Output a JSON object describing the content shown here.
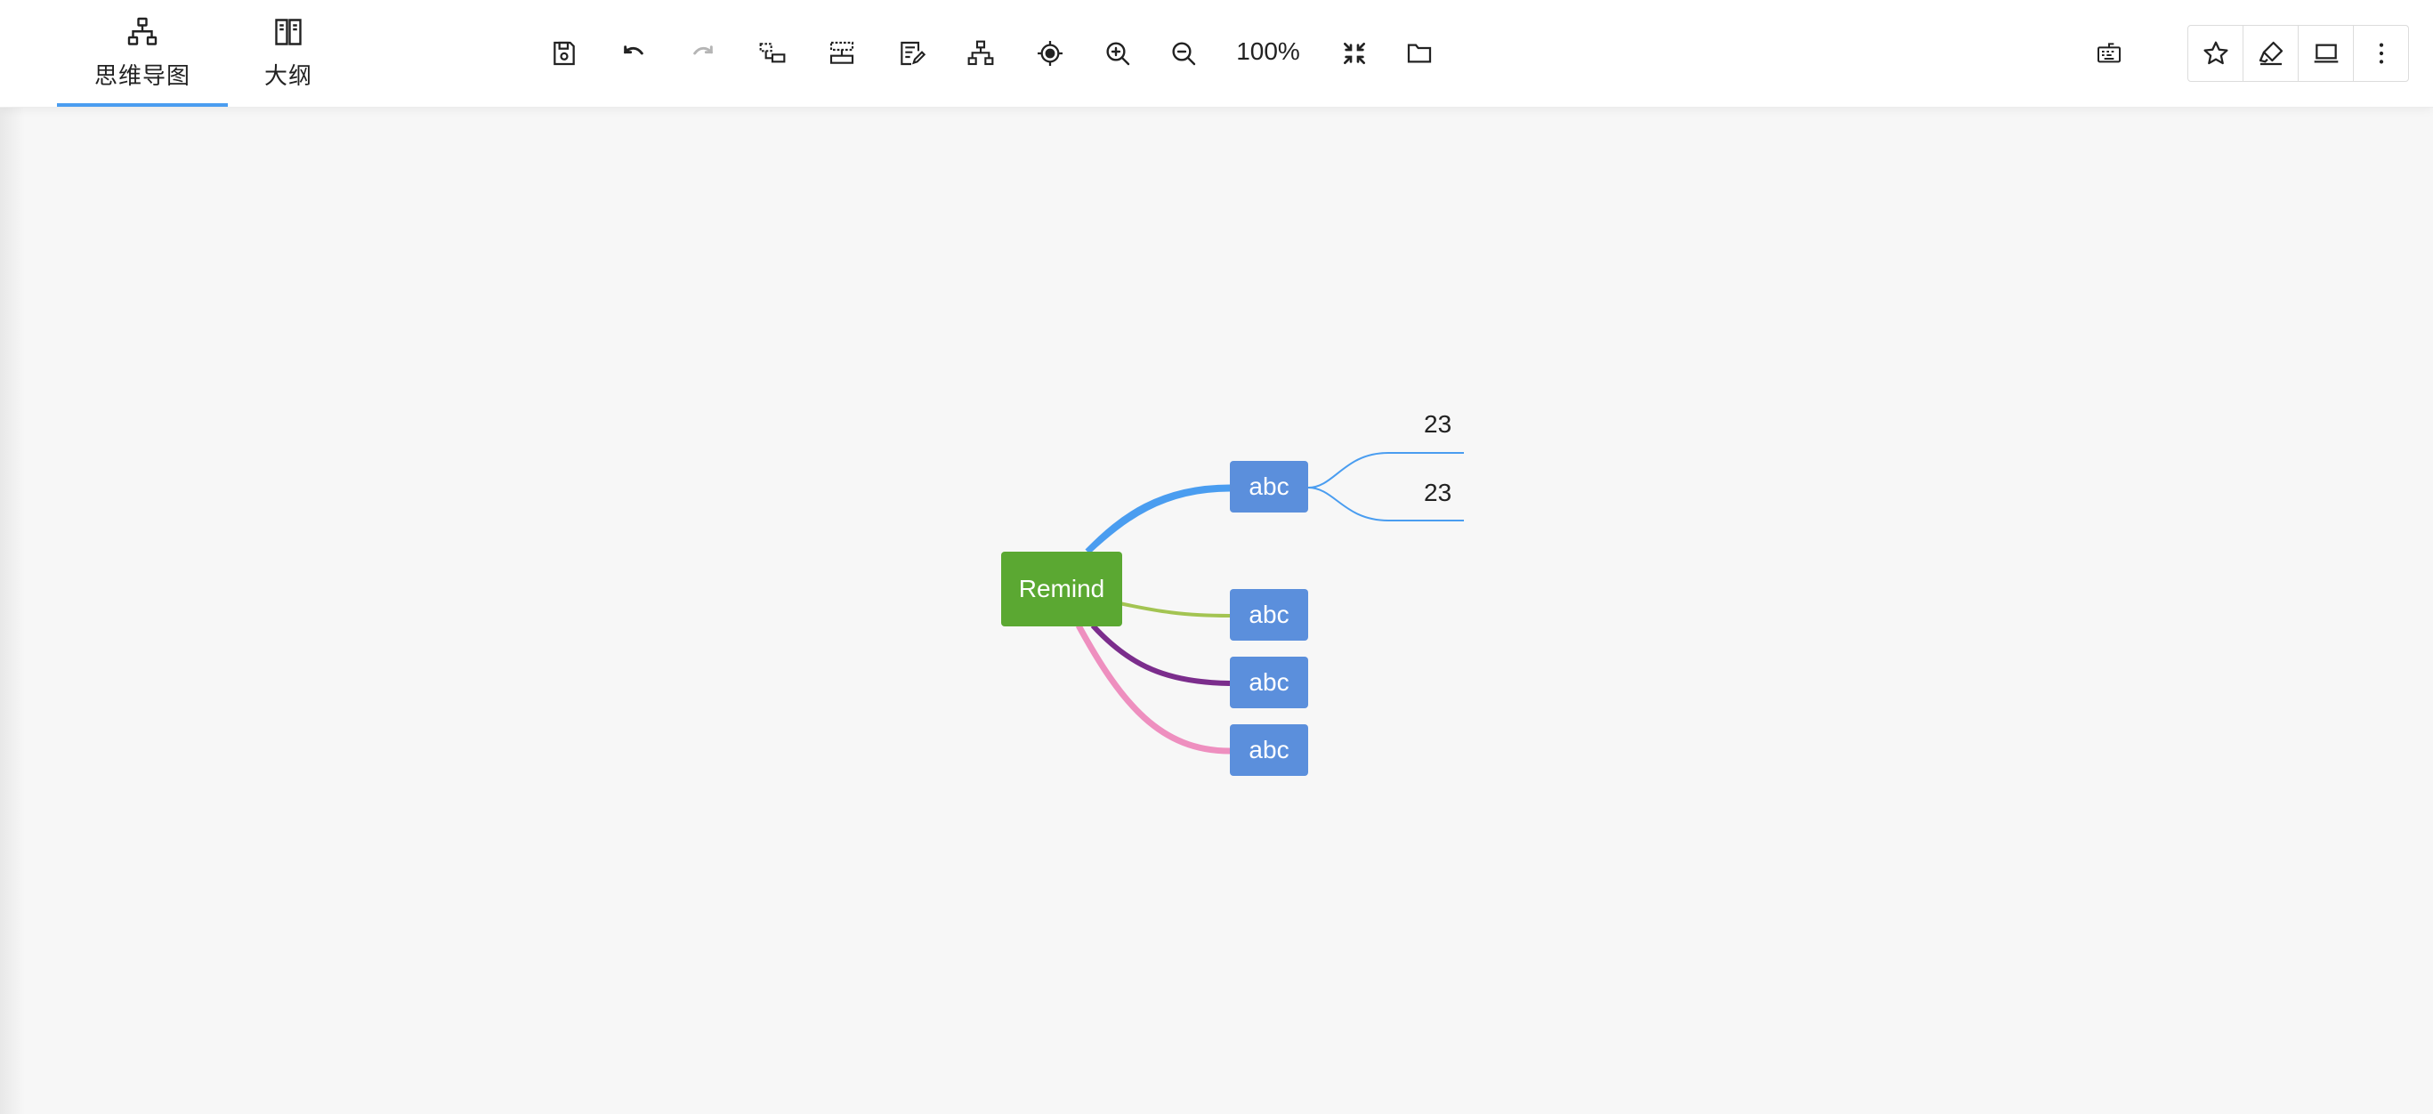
{
  "view_tabs": [
    {
      "label": "思维导图",
      "icon": "mindmap-icon",
      "active": true
    },
    {
      "label": "大纲",
      "icon": "outline-book-icon",
      "active": false
    }
  ],
  "toolbar": {
    "tools": [
      {
        "name": "save",
        "icon": "save-icon",
        "enabled": true
      },
      {
        "name": "undo",
        "icon": "undo-icon",
        "enabled": true
      },
      {
        "name": "redo",
        "icon": "redo-icon",
        "enabled": false
      },
      {
        "name": "insert-child",
        "icon": "insert-child-node-icon",
        "enabled": true
      },
      {
        "name": "insert-sibling",
        "icon": "insert-sibling-node-icon",
        "enabled": true
      },
      {
        "name": "edit-note",
        "icon": "note-edit-icon",
        "enabled": true
      },
      {
        "name": "structure",
        "icon": "structure-icon",
        "enabled": true
      },
      {
        "name": "locate",
        "icon": "locate-center-icon",
        "enabled": true
      },
      {
        "name": "zoom-in",
        "icon": "zoom-in-icon",
        "enabled": true
      },
      {
        "name": "zoom-out",
        "icon": "zoom-out-icon",
        "enabled": true
      },
      {
        "name": "fit",
        "icon": "fit-screen-icon",
        "enabled": true
      },
      {
        "name": "open",
        "icon": "folder-icon",
        "enabled": true
      }
    ],
    "zoom_label": "100%"
  },
  "right_actions": [
    {
      "name": "keyboard",
      "icon": "keyboard-shortcuts-icon"
    },
    {
      "name": "favorite",
      "icon": "star-icon"
    },
    {
      "name": "theme",
      "icon": "highlighter-icon"
    },
    {
      "name": "present",
      "icon": "laptop-icon"
    },
    {
      "name": "more",
      "icon": "more-vertical-icon"
    }
  ],
  "mindmap": {
    "root": {
      "text": "Remind",
      "color": "#5ba832"
    },
    "branches": [
      {
        "text": "abc",
        "line_color": "#4a9df0",
        "children": [
          "23",
          "23"
        ]
      },
      {
        "text": "abc",
        "line_color": "#a3c452",
        "children": []
      },
      {
        "text": "abc",
        "line_color": "#7b2d8c",
        "children": []
      },
      {
        "text": "abc",
        "line_color": "#ee8fbf",
        "children": []
      }
    ],
    "branch_color": "#5b8fdc"
  },
  "colors": {
    "accent": "#4a9df0",
    "canvas_bg": "#f7f7f7",
    "toolbar_bg": "#ffffff"
  }
}
